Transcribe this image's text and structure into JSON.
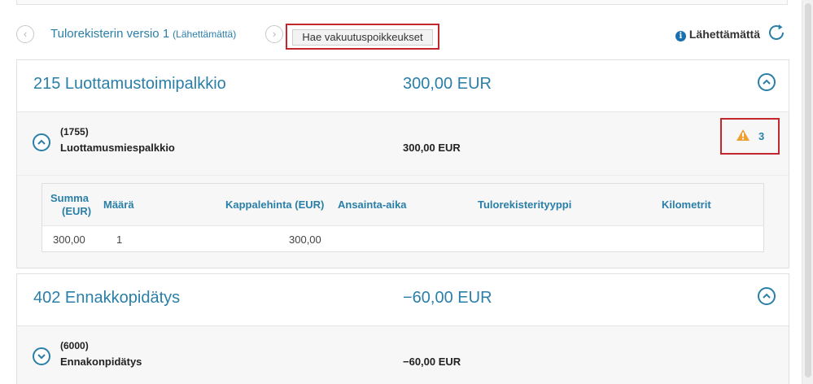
{
  "version": {
    "title": "Tulorekisterin versio 1",
    "status": "(Lähettämättä)",
    "fetch_button": "Hae vakuutuspoikkeukset",
    "right_status": "Lähettämättä"
  },
  "cards": [
    {
      "title": "215 Luottamustoimipalkkio",
      "amount": "300,00 EUR",
      "sub": {
        "code": "(1755)",
        "name": "Luottamusmiespalkkio",
        "amount": "300,00 EUR",
        "warning_count": "3"
      },
      "table": {
        "headers": {
          "summa_1": "Summa",
          "summa_2": "(EUR)",
          "maara": "Määrä",
          "kappalehinta": "Kappalehinta (EUR)",
          "ansainta": "Ansainta-aika",
          "tyyppi": "Tulorekisterityyppi",
          "kilometrit": "Kilometrit"
        },
        "row": {
          "summa": "300,00",
          "maara": "1",
          "kappalehinta": "300,00"
        }
      }
    },
    {
      "title": "402 Ennakkopidätys",
      "amount": "−60,00 EUR",
      "sub": {
        "code": "(6000)",
        "name": "Ennakonpidätys",
        "amount": "−60,00 EUR"
      }
    }
  ],
  "colors": {
    "accent": "#2a7fa8",
    "highlight": "#c4262e",
    "warning": "#f0a030",
    "info": "#1a6fb0"
  },
  "icons": {
    "prev": "chevron-left-icon",
    "next": "chevron-right-icon",
    "info": "info-icon",
    "refresh": "refresh-icon",
    "collapse": "chevron-up-icon",
    "expand": "chevron-down-icon",
    "warning": "warning-triangle-icon"
  }
}
